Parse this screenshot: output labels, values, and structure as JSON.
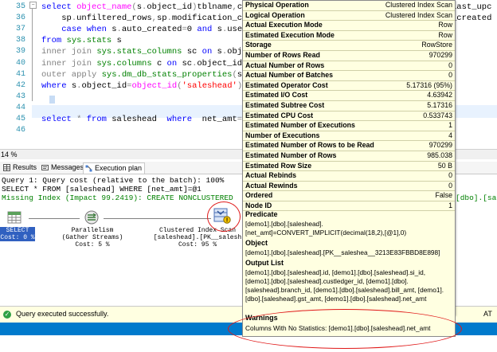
{
  "editor": {
    "lines": [
      {
        "num": "35",
        "parts": [
          [
            "kw",
            "select "
          ],
          [
            "fn",
            "object_name"
          ],
          [
            "gray",
            "("
          ],
          [
            "",
            "s"
          ],
          [
            "gray",
            "."
          ],
          [
            "",
            "object_id"
          ],
          [
            "gray",
            ")"
          ],
          [
            "",
            "tblname"
          ],
          [
            "gray",
            ","
          ],
          [
            "",
            "c"
          ],
          [
            "gray",
            "."
          ],
          [
            "",
            "na"
          ]
        ]
      },
      {
        "num": "36",
        "parts": [
          [
            "",
            "    sp"
          ],
          [
            "gray",
            "."
          ],
          [
            "",
            "unfiltered_rows"
          ],
          [
            "gray",
            ","
          ],
          [
            "",
            "sp"
          ],
          [
            "gray",
            "."
          ],
          [
            "",
            "modification_coun"
          ]
        ]
      },
      {
        "num": "37",
        "parts": [
          [
            "",
            "    "
          ],
          [
            "kw",
            "case when "
          ],
          [
            "",
            "s"
          ],
          [
            "gray",
            "."
          ],
          [
            "",
            "auto_created"
          ],
          [
            "gray",
            "="
          ],
          [
            "",
            "0 "
          ],
          [
            "kw",
            "and "
          ],
          [
            "",
            "s"
          ],
          [
            "gray",
            "."
          ],
          [
            "",
            "user_c"
          ]
        ]
      },
      {
        "num": "38",
        "parts": [
          [
            "kw",
            "from "
          ],
          [
            "sysobj",
            "sys.stats "
          ],
          [
            "",
            "s"
          ]
        ]
      },
      {
        "num": "39",
        "parts": [
          [
            "gray",
            "inner join "
          ],
          [
            "sysobj",
            "sys.stats_columns "
          ],
          [
            "",
            "sc "
          ],
          [
            "kw",
            "on "
          ],
          [
            "",
            "s"
          ],
          [
            "gray",
            "."
          ],
          [
            "",
            "object_"
          ]
        ]
      },
      {
        "num": "40",
        "parts": [
          [
            "gray",
            "inner join "
          ],
          [
            "sysobj",
            "sys.columns "
          ],
          [
            "",
            "c "
          ],
          [
            "kw",
            "on "
          ],
          [
            "",
            "sc"
          ],
          [
            "gray",
            "."
          ],
          [
            "",
            "object_id "
          ],
          [
            "gray",
            "= "
          ],
          [
            "",
            "c"
          ]
        ]
      },
      {
        "num": "41",
        "parts": [
          [
            "gray",
            "outer apply "
          ],
          [
            "sysobj",
            "sys.dm_db_stats_properties"
          ],
          [
            "gray",
            "("
          ],
          [
            "",
            "s"
          ],
          [
            "gray",
            "."
          ],
          [
            "",
            "obj"
          ]
        ]
      },
      {
        "num": "42",
        "parts": [
          [
            "kw",
            "where "
          ],
          [
            "",
            "s"
          ],
          [
            "gray",
            "."
          ],
          [
            "",
            "object_id"
          ],
          [
            "gray",
            "="
          ],
          [
            "fn",
            "object_id"
          ],
          [
            "gray",
            "("
          ],
          [
            "str",
            "'saleshead'"
          ],
          [
            "gray",
            ")"
          ]
        ]
      },
      {
        "num": "43",
        "parts": []
      },
      {
        "num": "44",
        "parts": []
      },
      {
        "num": "45",
        "parts": [
          [
            "kw",
            "select "
          ],
          [
            "gray",
            "* "
          ],
          [
            "kw",
            "from "
          ],
          [
            "",
            "saleshead  "
          ],
          [
            "kw",
            "where  "
          ],
          [
            "",
            "net_amt"
          ],
          [
            "gray",
            "="
          ],
          [
            "",
            "0"
          ]
        ]
      },
      {
        "num": "46",
        "parts": []
      }
    ],
    "right_fragments": {
      "line35": "last_upc",
      "line36": "_created"
    }
  },
  "zoom": "14 %",
  "tabs": [
    {
      "label": "Results"
    },
    {
      "label": "Messages"
    },
    {
      "label": "Execution plan"
    }
  ],
  "messages": {
    "query": "Query 1: Query cost (relative to the batch): 100%",
    "sql": "SELECT * FROM [saleshead] WHERE [net_amt]=@1",
    "missing": "Missing Index (Impact 99.2419): CREATE NONCLUSTERED",
    "missing_tail": "[dbo].[sal"
  },
  "plan": {
    "select": {
      "name": "SELECT",
      "cost": "Cost: 0 %"
    },
    "parallelism": {
      "name": "Parallelism",
      "sub": "(Gather Streams)",
      "cost": "Cost: 5 %"
    },
    "scan": {
      "name": "Clustered Index Scan",
      "sub": "[saleshead].[PK__salesh",
      "cost": "Cost: 95 %"
    }
  },
  "status": {
    "text": "Query executed successfully.",
    "right": "AT"
  },
  "popup": {
    "rows": [
      {
        "k": "Physical Operation",
        "v": "Clustered Index Scan"
      },
      {
        "k": "Logical Operation",
        "v": "Clustered Index Scan"
      },
      {
        "k": "Actual Execution Mode",
        "v": "Row"
      },
      {
        "k": "Estimated Execution Mode",
        "v": "Row"
      },
      {
        "k": "Storage",
        "v": "RowStore"
      },
      {
        "k": "Number of Rows Read",
        "v": "970299"
      },
      {
        "k": "Actual Number of Rows",
        "v": "0"
      },
      {
        "k": "Actual Number of Batches",
        "v": "0"
      },
      {
        "k": "Estimated Operator Cost",
        "v": "5.17316 (95%)"
      },
      {
        "k": "Estimated I/O Cost",
        "v": "4.63942"
      },
      {
        "k": "Estimated Subtree Cost",
        "v": "5.17316"
      },
      {
        "k": "Estimated CPU Cost",
        "v": "0.533743"
      },
      {
        "k": "Estimated Number of Executions",
        "v": "1"
      },
      {
        "k": "Number of Executions",
        "v": "4"
      },
      {
        "k": "Estimated Number of Rows to be Read",
        "v": "970299"
      },
      {
        "k": "Estimated Number of Rows",
        "v": "985.038"
      },
      {
        "k": "Estimated Row Size",
        "v": "50 B"
      },
      {
        "k": "Actual Rebinds",
        "v": "0"
      },
      {
        "k": "Actual Rewinds",
        "v": "0"
      },
      {
        "k": "Ordered",
        "v": "False"
      },
      {
        "k": "Node ID",
        "v": "1"
      }
    ],
    "predicate_h": "Predicate",
    "predicate": "[demo1].[dbo].[saleshead].[net_amt]=CONVERT_IMPLICIT(decimal(18,2),[@1],0)",
    "object_h": "Object",
    "object": "[demo1].[dbo].[saleshead].[PK__saleshea__3213E83FBBD8E898]",
    "output_h": "Output List",
    "output": "[demo1].[dbo].[saleshead].id, [demo1].[dbo].[saleshead].si_id, [demo1].[dbo].[saleshead].custledger_id, [demo1].[dbo].[saleshead].branch_id, [demo1].[dbo].[saleshead].bill_amt, [demo1].[dbo].[saleshead].gst_amt, [demo1].[dbo].[saleshead].net_amt",
    "warnings_h": "Warnings",
    "warnings": "Columns With No Statistics: [demo1].[dbo].[saleshead].net_amt"
  },
  "colors": {
    "accent": "#007acc",
    "highlight": "#e01818",
    "tooltip_bg": "#ffffe1"
  }
}
